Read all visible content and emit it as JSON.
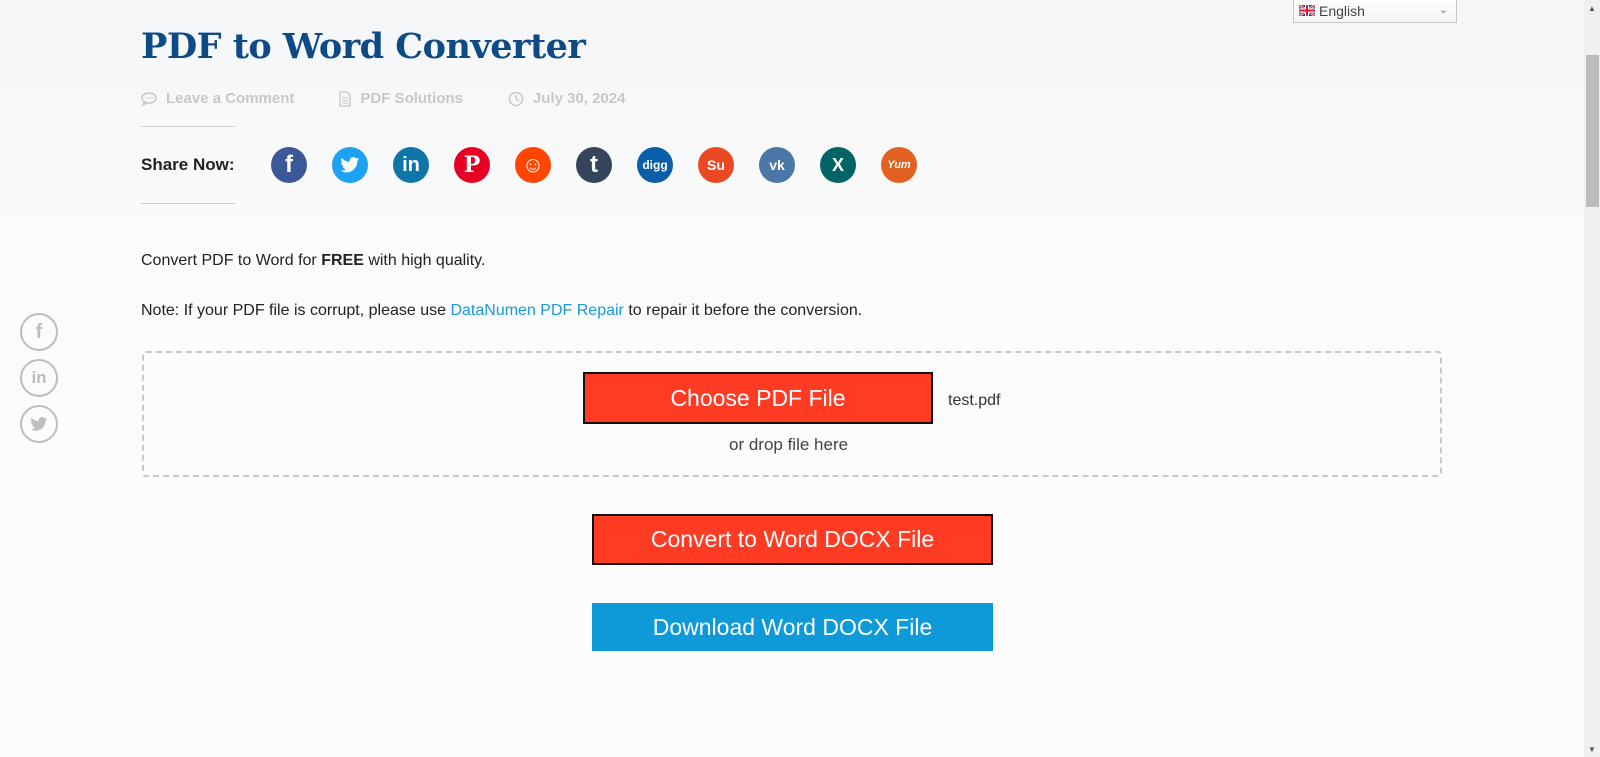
{
  "language_selector": {
    "selected": "English",
    "flag_icon": "uk-flag-icon",
    "chevron_icon": "chevron-down-icon"
  },
  "article": {
    "title": "PDF to Word Converter",
    "meta": {
      "comments": {
        "label": "Leave a Comment",
        "icon": "comment-icon"
      },
      "category": {
        "label": "PDF Solutions",
        "icon": "document-icon"
      },
      "date": {
        "label": "July 30, 2024",
        "icon": "clock-icon"
      }
    }
  },
  "share": {
    "label": "Share Now:",
    "icons": [
      {
        "name": "facebook",
        "glyph": "f",
        "color": "#3b5998"
      },
      {
        "name": "twitter",
        "glyph": "🐦",
        "color": "#1da1f2"
      },
      {
        "name": "linkedin",
        "glyph": "in",
        "color": "#0e76a8"
      },
      {
        "name": "pinterest",
        "glyph": "P",
        "color": "#e60023"
      },
      {
        "name": "reddit",
        "glyph": "☺",
        "color": "#ff4500"
      },
      {
        "name": "tumblr",
        "glyph": "t",
        "color": "#35465c"
      },
      {
        "name": "digg",
        "glyph": "digg",
        "color": "#0b5ea8"
      },
      {
        "name": "stumbleupon",
        "glyph": "Su",
        "color": "#eb4924"
      },
      {
        "name": "vk",
        "glyph": "vk",
        "color": "#4a76a8"
      },
      {
        "name": "xing",
        "glyph": "X",
        "color": "#026466"
      },
      {
        "name": "yummly",
        "glyph": "Yum",
        "color": "#e16120"
      }
    ]
  },
  "side_share": {
    "icons": [
      {
        "name": "facebook",
        "glyph": "f"
      },
      {
        "name": "linkedin",
        "glyph": "in"
      },
      {
        "name": "twitter",
        "glyph": "🐦"
      }
    ]
  },
  "content": {
    "intro_prefix": "Convert PDF to Word for ",
    "intro_bold": "FREE",
    "intro_suffix": " with high quality.",
    "note_prefix": "Note: If your PDF file is corrupt, please use ",
    "note_link": "DataNumen PDF Repair",
    "note_suffix": " to repair it before the conversion."
  },
  "uploader": {
    "choose_button": "Choose PDF File",
    "selected_file": "test.pdf",
    "drop_hint": "or drop file here"
  },
  "actions": {
    "convert_button": "Convert to Word DOCX File",
    "download_button": "Download Word DOCX File"
  },
  "colors": {
    "title": "#0e4a86",
    "primary_button": "#ff3b24",
    "download_button": "#0e9ad9",
    "link": "#1a9ad6"
  }
}
